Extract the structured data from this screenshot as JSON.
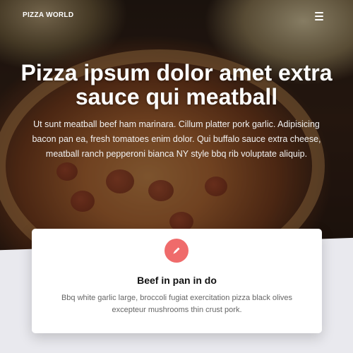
{
  "nav": {
    "brand": "PIZZA WORLD",
    "menu_icon": "hamburger-menu-icon"
  },
  "hero": {
    "headline": "Pizza ipsum dolor amet extra sauce qui meatball",
    "lead": "Ut sunt meatball beef ham marinara. Cillum platter pork garlic. Adipisicing bacon pan ea, fresh tomatoes enim dolor. Qui buffalo sauce extra cheese, meatball ranch pepperoni bianca NY style bbq rib voluptate aliquip."
  },
  "feature_card": {
    "icon": "pencil-icon",
    "icon_color": "#ef6b6b",
    "title": "Beef in pan in do",
    "text": "Bbq white garlic large, broccoli fugiat exercitation pizza black olives excepteur mushrooms thin crust pork."
  }
}
